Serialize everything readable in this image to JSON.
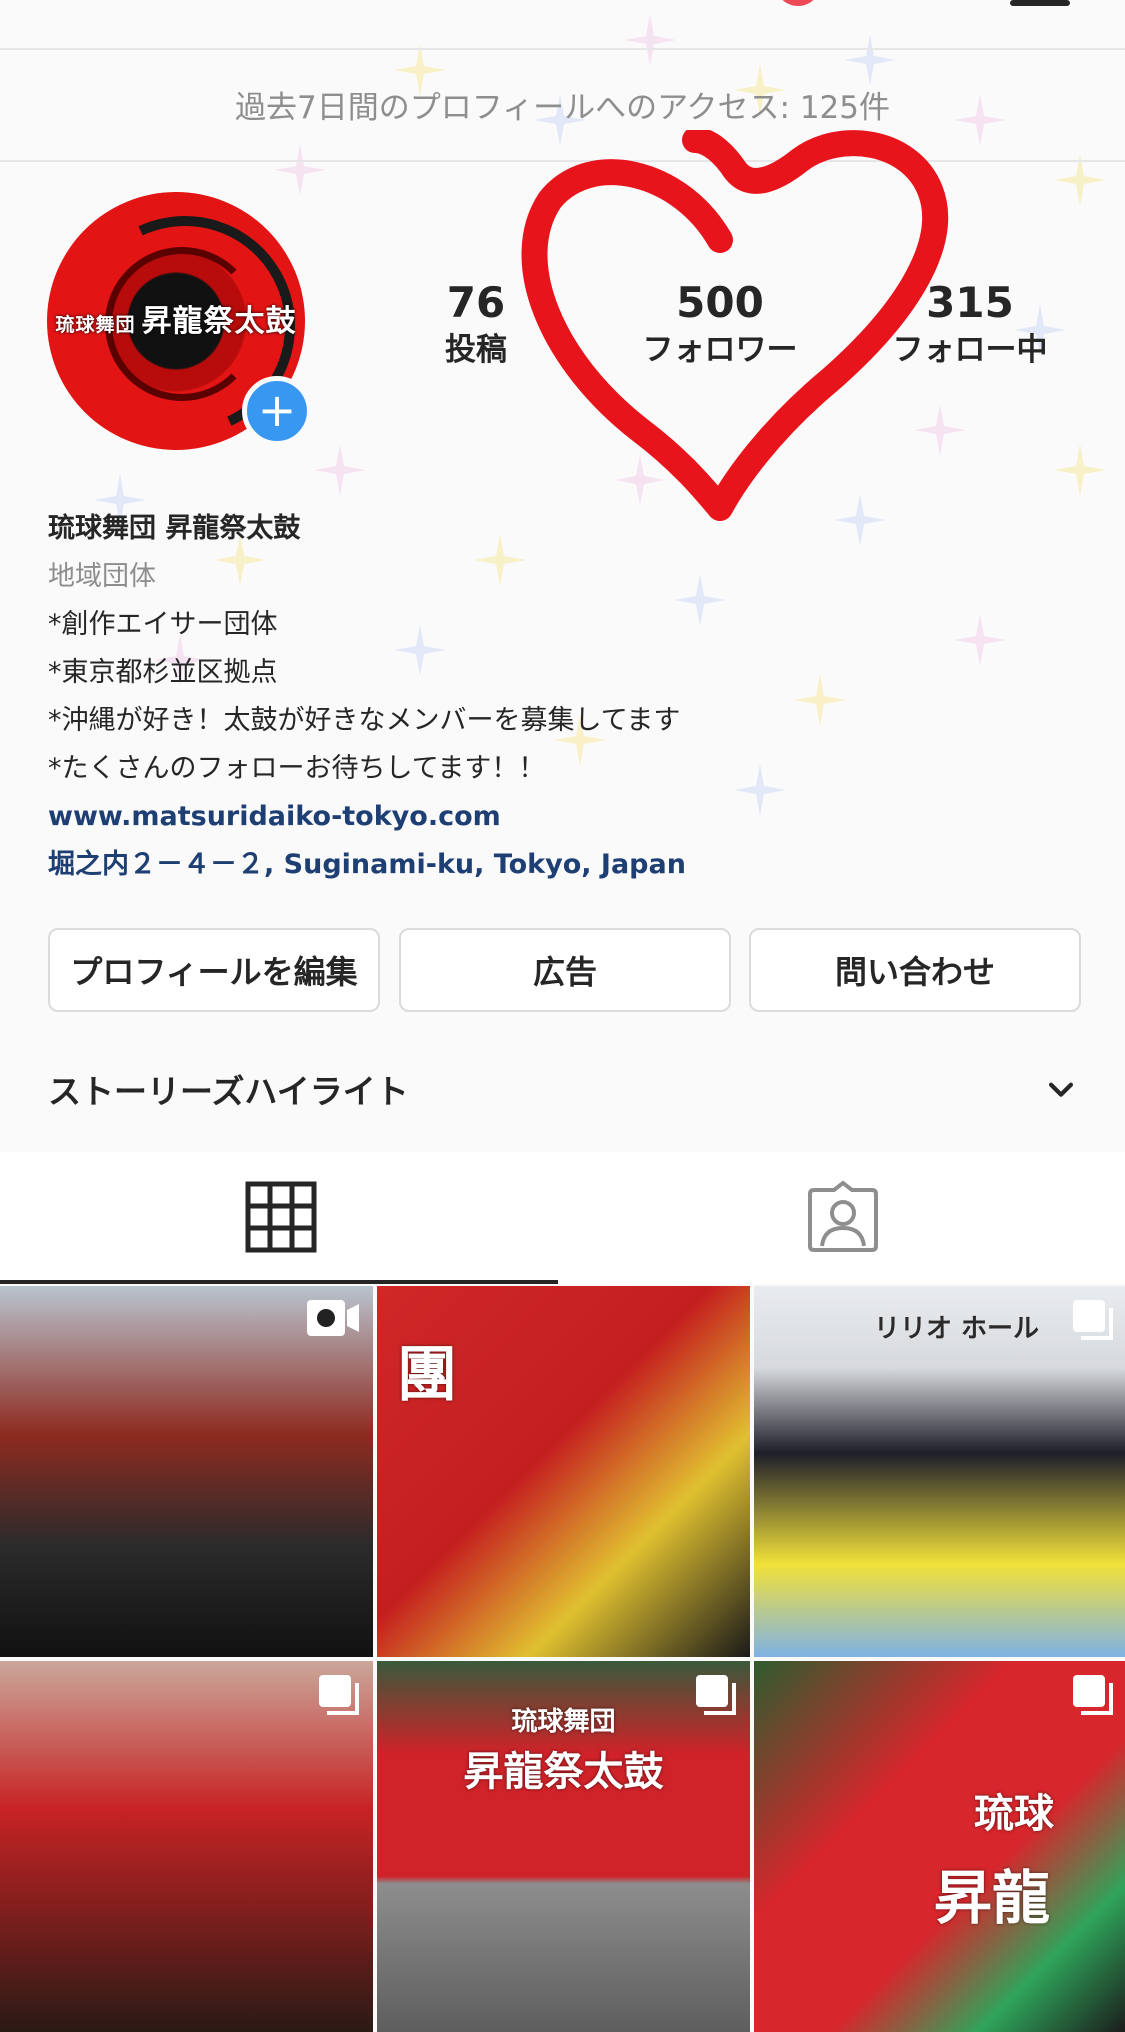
{
  "insights": {
    "text": "過去7日間のプロフィールへのアクセス: 125件"
  },
  "profile": {
    "avatar": {
      "logo_small": "琉球舞団",
      "logo_main": "昇龍祭太鼓"
    },
    "stats": [
      {
        "value": "76",
        "label": "投稿"
      },
      {
        "value": "500",
        "label": "フォロワー"
      },
      {
        "value": "315",
        "label": "フォロー中"
      }
    ]
  },
  "bio": {
    "name": "琉球舞団 昇龍祭太鼓",
    "category": "地域団体",
    "lines": [
      "*創作エイサー団体",
      "*東京都杉並区拠点",
      "*沖縄が好き！太鼓が好きなメンバーを募集してます",
      "*たくさんのフォローお待ちしてます！！"
    ],
    "website": "www.matsuridaiko-tokyo.com",
    "address": "堀之内２－４－２, Suginami-ku, Tokyo, Japan"
  },
  "buttons": {
    "edit": "プロフィールを編集",
    "ads": "広告",
    "contact": "問い合わせ"
  },
  "highlights": {
    "title": "ストーリーズハイライト"
  },
  "tiles": {
    "t2": "團",
    "t3": "リリオ ホール",
    "t5_small": "琉球舞団",
    "t5_main": "昇龍祭太鼓",
    "t6_a": "琉球",
    "t6_b": "昇龍"
  },
  "colors": {
    "accent_blue": "#3897f0",
    "link": "#1e3f73",
    "heart": "#e8141c",
    "notification": "#ed4956"
  }
}
